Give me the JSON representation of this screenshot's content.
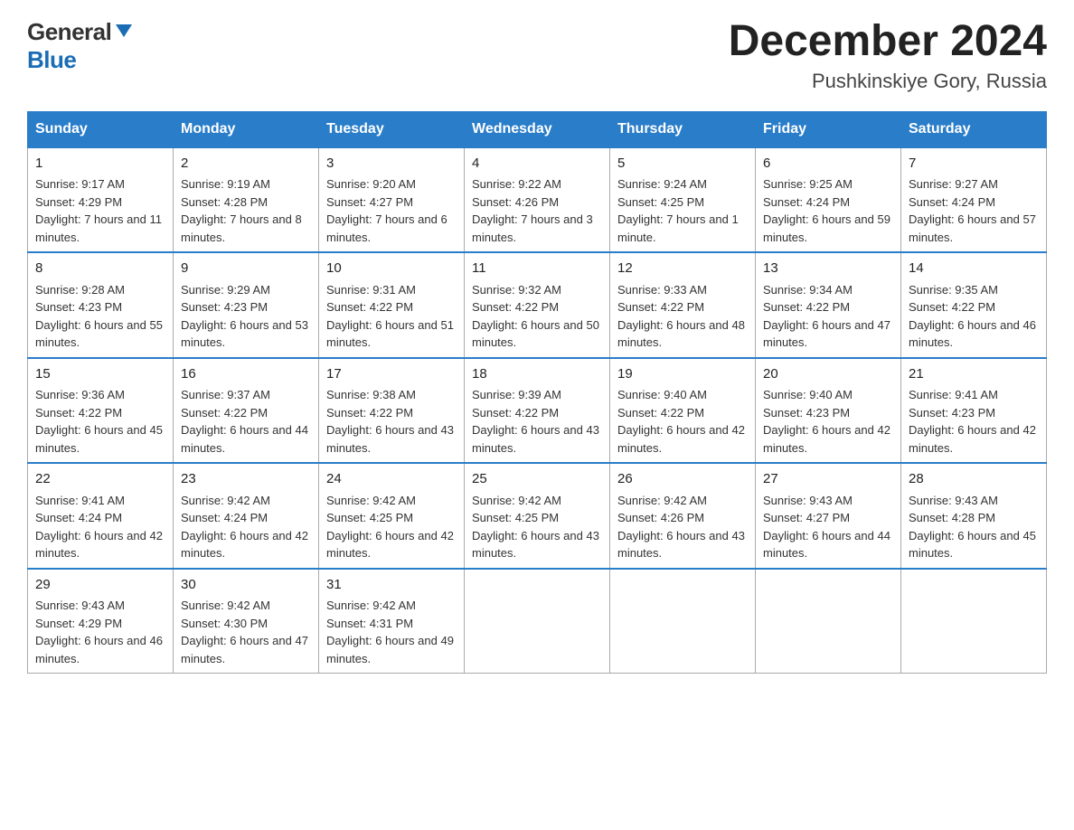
{
  "header": {
    "month_year": "December 2024",
    "location": "Pushkinskiye Gory, Russia",
    "logo_general": "General",
    "logo_blue": "Blue"
  },
  "days_of_week": [
    "Sunday",
    "Monday",
    "Tuesday",
    "Wednesday",
    "Thursday",
    "Friday",
    "Saturday"
  ],
  "weeks": [
    [
      {
        "day": "1",
        "sunrise": "9:17 AM",
        "sunset": "4:29 PM",
        "daylight": "7 hours and 11 minutes."
      },
      {
        "day": "2",
        "sunrise": "9:19 AM",
        "sunset": "4:28 PM",
        "daylight": "7 hours and 8 minutes."
      },
      {
        "day": "3",
        "sunrise": "9:20 AM",
        "sunset": "4:27 PM",
        "daylight": "7 hours and 6 minutes."
      },
      {
        "day": "4",
        "sunrise": "9:22 AM",
        "sunset": "4:26 PM",
        "daylight": "7 hours and 3 minutes."
      },
      {
        "day": "5",
        "sunrise": "9:24 AM",
        "sunset": "4:25 PM",
        "daylight": "7 hours and 1 minute."
      },
      {
        "day": "6",
        "sunrise": "9:25 AM",
        "sunset": "4:24 PM",
        "daylight": "6 hours and 59 minutes."
      },
      {
        "day": "7",
        "sunrise": "9:27 AM",
        "sunset": "4:24 PM",
        "daylight": "6 hours and 57 minutes."
      }
    ],
    [
      {
        "day": "8",
        "sunrise": "9:28 AM",
        "sunset": "4:23 PM",
        "daylight": "6 hours and 55 minutes."
      },
      {
        "day": "9",
        "sunrise": "9:29 AM",
        "sunset": "4:23 PM",
        "daylight": "6 hours and 53 minutes."
      },
      {
        "day": "10",
        "sunrise": "9:31 AM",
        "sunset": "4:22 PM",
        "daylight": "6 hours and 51 minutes."
      },
      {
        "day": "11",
        "sunrise": "9:32 AM",
        "sunset": "4:22 PM",
        "daylight": "6 hours and 50 minutes."
      },
      {
        "day": "12",
        "sunrise": "9:33 AM",
        "sunset": "4:22 PM",
        "daylight": "6 hours and 48 minutes."
      },
      {
        "day": "13",
        "sunrise": "9:34 AM",
        "sunset": "4:22 PM",
        "daylight": "6 hours and 47 minutes."
      },
      {
        "day": "14",
        "sunrise": "9:35 AM",
        "sunset": "4:22 PM",
        "daylight": "6 hours and 46 minutes."
      }
    ],
    [
      {
        "day": "15",
        "sunrise": "9:36 AM",
        "sunset": "4:22 PM",
        "daylight": "6 hours and 45 minutes."
      },
      {
        "day": "16",
        "sunrise": "9:37 AM",
        "sunset": "4:22 PM",
        "daylight": "6 hours and 44 minutes."
      },
      {
        "day": "17",
        "sunrise": "9:38 AM",
        "sunset": "4:22 PM",
        "daylight": "6 hours and 43 minutes."
      },
      {
        "day": "18",
        "sunrise": "9:39 AM",
        "sunset": "4:22 PM",
        "daylight": "6 hours and 43 minutes."
      },
      {
        "day": "19",
        "sunrise": "9:40 AM",
        "sunset": "4:22 PM",
        "daylight": "6 hours and 42 minutes."
      },
      {
        "day": "20",
        "sunrise": "9:40 AM",
        "sunset": "4:23 PM",
        "daylight": "6 hours and 42 minutes."
      },
      {
        "day": "21",
        "sunrise": "9:41 AM",
        "sunset": "4:23 PM",
        "daylight": "6 hours and 42 minutes."
      }
    ],
    [
      {
        "day": "22",
        "sunrise": "9:41 AM",
        "sunset": "4:24 PM",
        "daylight": "6 hours and 42 minutes."
      },
      {
        "day": "23",
        "sunrise": "9:42 AM",
        "sunset": "4:24 PM",
        "daylight": "6 hours and 42 minutes."
      },
      {
        "day": "24",
        "sunrise": "9:42 AM",
        "sunset": "4:25 PM",
        "daylight": "6 hours and 42 minutes."
      },
      {
        "day": "25",
        "sunrise": "9:42 AM",
        "sunset": "4:25 PM",
        "daylight": "6 hours and 43 minutes."
      },
      {
        "day": "26",
        "sunrise": "9:42 AM",
        "sunset": "4:26 PM",
        "daylight": "6 hours and 43 minutes."
      },
      {
        "day": "27",
        "sunrise": "9:43 AM",
        "sunset": "4:27 PM",
        "daylight": "6 hours and 44 minutes."
      },
      {
        "day": "28",
        "sunrise": "9:43 AM",
        "sunset": "4:28 PM",
        "daylight": "6 hours and 45 minutes."
      }
    ],
    [
      {
        "day": "29",
        "sunrise": "9:43 AM",
        "sunset": "4:29 PM",
        "daylight": "6 hours and 46 minutes."
      },
      {
        "day": "30",
        "sunrise": "9:42 AM",
        "sunset": "4:30 PM",
        "daylight": "6 hours and 47 minutes."
      },
      {
        "day": "31",
        "sunrise": "9:42 AM",
        "sunset": "4:31 PM",
        "daylight": "6 hours and 49 minutes."
      },
      null,
      null,
      null,
      null
    ]
  ],
  "labels": {
    "sunrise": "Sunrise:",
    "sunset": "Sunset:",
    "daylight": "Daylight:"
  }
}
